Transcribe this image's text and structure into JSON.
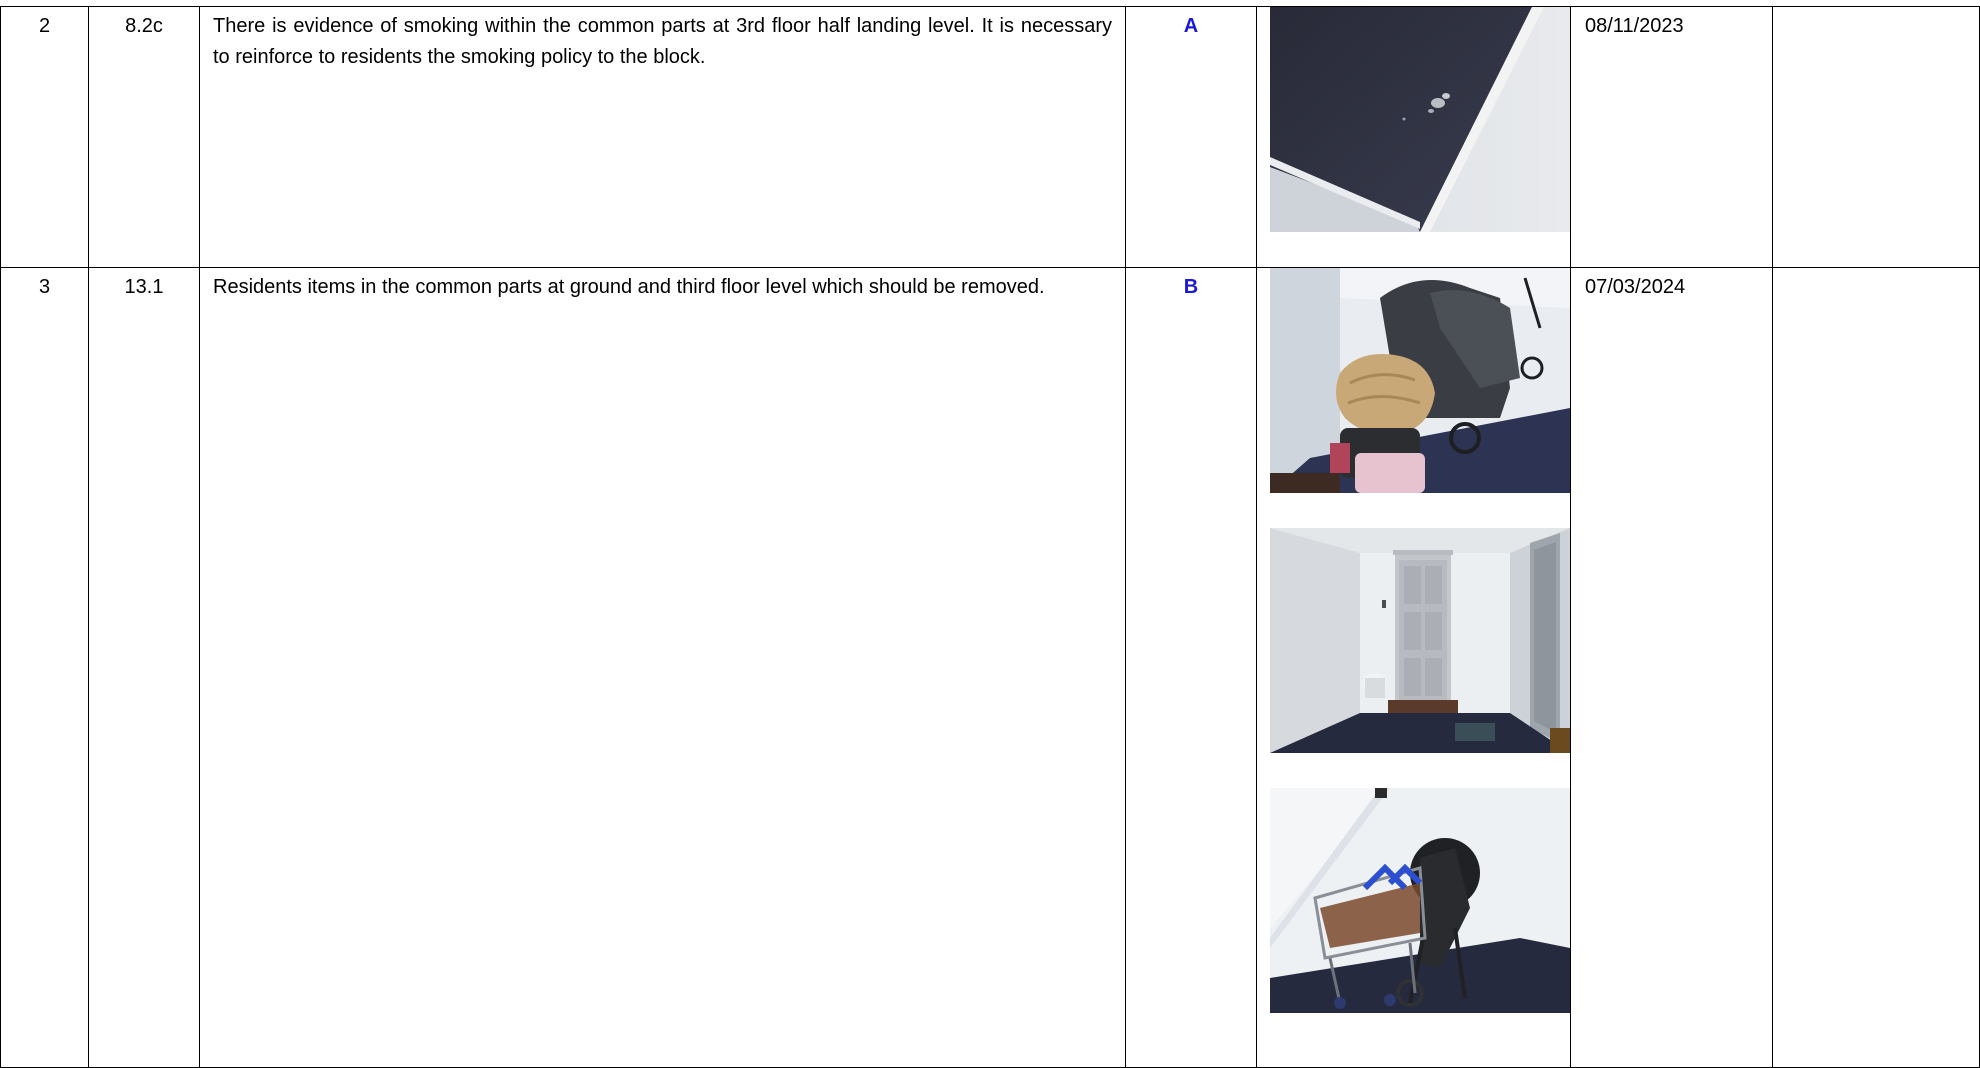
{
  "rows": [
    {
      "no": "2",
      "ref": "8.2c",
      "description": "There is evidence of smoking within the common parts at 3rd floor half landing level.  It is necessary to reinforce to residents the smoking policy to the block.",
      "priority": "A",
      "date": "08/11/2023",
      "completed": "",
      "photos": [
        "carpet-corner-burn-photo"
      ]
    },
    {
      "no": "3",
      "ref": "13.1",
      "description": "Residents items in the common parts at ground and third floor level which should be removed.",
      "priority": "B",
      "date": "07/03/2024",
      "completed": "",
      "photos": [
        "pushchair-and-coat-photo",
        "corridor-door-photo",
        "shopping-trolley-pram-photo"
      ]
    }
  ],
  "colors": {
    "priority": "#1a1ad6",
    "border": "#000000"
  }
}
